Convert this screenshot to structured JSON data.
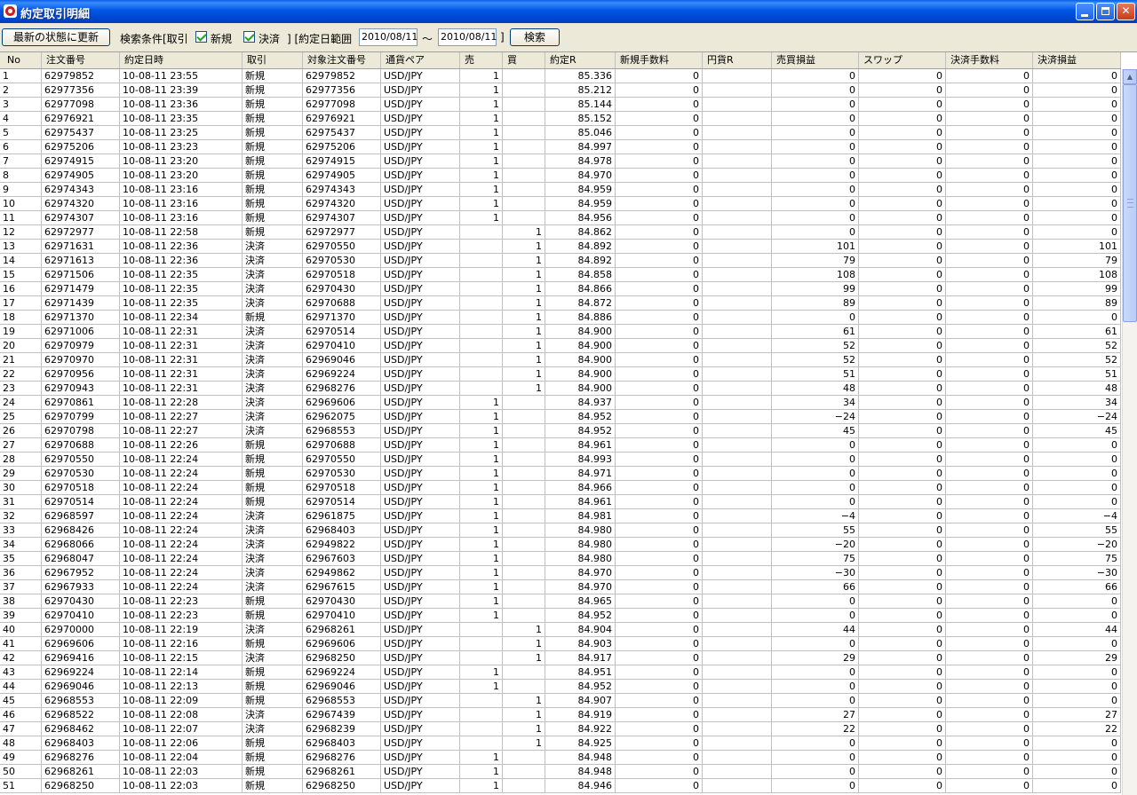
{
  "window": {
    "title": "約定取引明細"
  },
  "toolbar": {
    "refresh_label": "最新の状態に更新",
    "filter_label": "検索条件[取引",
    "check_new_label": "新規",
    "check_close_label": "決済",
    "range_label": "]  [約定日範囲",
    "date_from": "2010/08/11",
    "tilde": "～",
    "date_to": "2010/08/11",
    "range_close": "]",
    "search_label": "検索"
  },
  "table": {
    "columns": [
      "No",
      "注文番号",
      "約定日時",
      "取引",
      "対象注文番号",
      "通貨ペア",
      "売",
      "買",
      "約定R",
      "新規手数料",
      "円貨R",
      "売買損益",
      "スワップ",
      "決済手数料",
      "決済損益"
    ],
    "rows": [
      [
        "1",
        "62979852",
        "10-08-11 23:55",
        "新規",
        "62979852",
        "USD/JPY",
        "1",
        "",
        "85.336",
        "0",
        "",
        "0",
        "0",
        "0",
        "0"
      ],
      [
        "2",
        "62977356",
        "10-08-11 23:39",
        "新規",
        "62977356",
        "USD/JPY",
        "1",
        "",
        "85.212",
        "0",
        "",
        "0",
        "0",
        "0",
        "0"
      ],
      [
        "3",
        "62977098",
        "10-08-11 23:36",
        "新規",
        "62977098",
        "USD/JPY",
        "1",
        "",
        "85.144",
        "0",
        "",
        "0",
        "0",
        "0",
        "0"
      ],
      [
        "4",
        "62976921",
        "10-08-11 23:35",
        "新規",
        "62976921",
        "USD/JPY",
        "1",
        "",
        "85.152",
        "0",
        "",
        "0",
        "0",
        "0",
        "0"
      ],
      [
        "5",
        "62975437",
        "10-08-11 23:25",
        "新規",
        "62975437",
        "USD/JPY",
        "1",
        "",
        "85.046",
        "0",
        "",
        "0",
        "0",
        "0",
        "0"
      ],
      [
        "6",
        "62975206",
        "10-08-11 23:23",
        "新規",
        "62975206",
        "USD/JPY",
        "1",
        "",
        "84.997",
        "0",
        "",
        "0",
        "0",
        "0",
        "0"
      ],
      [
        "7",
        "62974915",
        "10-08-11 23:20",
        "新規",
        "62974915",
        "USD/JPY",
        "1",
        "",
        "84.978",
        "0",
        "",
        "0",
        "0",
        "0",
        "0"
      ],
      [
        "8",
        "62974905",
        "10-08-11 23:20",
        "新規",
        "62974905",
        "USD/JPY",
        "1",
        "",
        "84.970",
        "0",
        "",
        "0",
        "0",
        "0",
        "0"
      ],
      [
        "9",
        "62974343",
        "10-08-11 23:16",
        "新規",
        "62974343",
        "USD/JPY",
        "1",
        "",
        "84.959",
        "0",
        "",
        "0",
        "0",
        "0",
        "0"
      ],
      [
        "10",
        "62974320",
        "10-08-11 23:16",
        "新規",
        "62974320",
        "USD/JPY",
        "1",
        "",
        "84.959",
        "0",
        "",
        "0",
        "0",
        "0",
        "0"
      ],
      [
        "11",
        "62974307",
        "10-08-11 23:16",
        "新規",
        "62974307",
        "USD/JPY",
        "1",
        "",
        "84.956",
        "0",
        "",
        "0",
        "0",
        "0",
        "0"
      ],
      [
        "12",
        "62972977",
        "10-08-11 22:58",
        "新規",
        "62972977",
        "USD/JPY",
        "",
        "1",
        "84.862",
        "0",
        "",
        "0",
        "0",
        "0",
        "0"
      ],
      [
        "13",
        "62971631",
        "10-08-11 22:36",
        "決済",
        "62970550",
        "USD/JPY",
        "",
        "1",
        "84.892",
        "0",
        "",
        "101",
        "0",
        "0",
        "101"
      ],
      [
        "14",
        "62971613",
        "10-08-11 22:36",
        "決済",
        "62970530",
        "USD/JPY",
        "",
        "1",
        "84.892",
        "0",
        "",
        "79",
        "0",
        "0",
        "79"
      ],
      [
        "15",
        "62971506",
        "10-08-11 22:35",
        "決済",
        "62970518",
        "USD/JPY",
        "",
        "1",
        "84.858",
        "0",
        "",
        "108",
        "0",
        "0",
        "108"
      ],
      [
        "16",
        "62971479",
        "10-08-11 22:35",
        "決済",
        "62970430",
        "USD/JPY",
        "",
        "1",
        "84.866",
        "0",
        "",
        "99",
        "0",
        "0",
        "99"
      ],
      [
        "17",
        "62971439",
        "10-08-11 22:35",
        "決済",
        "62970688",
        "USD/JPY",
        "",
        "1",
        "84.872",
        "0",
        "",
        "89",
        "0",
        "0",
        "89"
      ],
      [
        "18",
        "62971370",
        "10-08-11 22:34",
        "新規",
        "62971370",
        "USD/JPY",
        "",
        "1",
        "84.886",
        "0",
        "",
        "0",
        "0",
        "0",
        "0"
      ],
      [
        "19",
        "62971006",
        "10-08-11 22:31",
        "決済",
        "62970514",
        "USD/JPY",
        "",
        "1",
        "84.900",
        "0",
        "",
        "61",
        "0",
        "0",
        "61"
      ],
      [
        "20",
        "62970979",
        "10-08-11 22:31",
        "決済",
        "62970410",
        "USD/JPY",
        "",
        "1",
        "84.900",
        "0",
        "",
        "52",
        "0",
        "0",
        "52"
      ],
      [
        "21",
        "62970970",
        "10-08-11 22:31",
        "決済",
        "62969046",
        "USD/JPY",
        "",
        "1",
        "84.900",
        "0",
        "",
        "52",
        "0",
        "0",
        "52"
      ],
      [
        "22",
        "62970956",
        "10-08-11 22:31",
        "決済",
        "62969224",
        "USD/JPY",
        "",
        "1",
        "84.900",
        "0",
        "",
        "51",
        "0",
        "0",
        "51"
      ],
      [
        "23",
        "62970943",
        "10-08-11 22:31",
        "決済",
        "62968276",
        "USD/JPY",
        "",
        "1",
        "84.900",
        "0",
        "",
        "48",
        "0",
        "0",
        "48"
      ],
      [
        "24",
        "62970861",
        "10-08-11 22:28",
        "決済",
        "62969606",
        "USD/JPY",
        "1",
        "",
        "84.937",
        "0",
        "",
        "34",
        "0",
        "0",
        "34"
      ],
      [
        "25",
        "62970799",
        "10-08-11 22:27",
        "決済",
        "62962075",
        "USD/JPY",
        "1",
        "",
        "84.952",
        "0",
        "",
        "−24",
        "0",
        "0",
        "−24"
      ],
      [
        "26",
        "62970798",
        "10-08-11 22:27",
        "決済",
        "62968553",
        "USD/JPY",
        "1",
        "",
        "84.952",
        "0",
        "",
        "45",
        "0",
        "0",
        "45"
      ],
      [
        "27",
        "62970688",
        "10-08-11 22:26",
        "新規",
        "62970688",
        "USD/JPY",
        "1",
        "",
        "84.961",
        "0",
        "",
        "0",
        "0",
        "0",
        "0"
      ],
      [
        "28",
        "62970550",
        "10-08-11 22:24",
        "新規",
        "62970550",
        "USD/JPY",
        "1",
        "",
        "84.993",
        "0",
        "",
        "0",
        "0",
        "0",
        "0"
      ],
      [
        "29",
        "62970530",
        "10-08-11 22:24",
        "新規",
        "62970530",
        "USD/JPY",
        "1",
        "",
        "84.971",
        "0",
        "",
        "0",
        "0",
        "0",
        "0"
      ],
      [
        "30",
        "62970518",
        "10-08-11 22:24",
        "新規",
        "62970518",
        "USD/JPY",
        "1",
        "",
        "84.966",
        "0",
        "",
        "0",
        "0",
        "0",
        "0"
      ],
      [
        "31",
        "62970514",
        "10-08-11 22:24",
        "新規",
        "62970514",
        "USD/JPY",
        "1",
        "",
        "84.961",
        "0",
        "",
        "0",
        "0",
        "0",
        "0"
      ],
      [
        "32",
        "62968597",
        "10-08-11 22:24",
        "決済",
        "62961875",
        "USD/JPY",
        "1",
        "",
        "84.981",
        "0",
        "",
        "−4",
        "0",
        "0",
        "−4"
      ],
      [
        "33",
        "62968426",
        "10-08-11 22:24",
        "決済",
        "62968403",
        "USD/JPY",
        "1",
        "",
        "84.980",
        "0",
        "",
        "55",
        "0",
        "0",
        "55"
      ],
      [
        "34",
        "62968066",
        "10-08-11 22:24",
        "決済",
        "62949822",
        "USD/JPY",
        "1",
        "",
        "84.980",
        "0",
        "",
        "−20",
        "0",
        "0",
        "−20"
      ],
      [
        "35",
        "62968047",
        "10-08-11 22:24",
        "決済",
        "62967603",
        "USD/JPY",
        "1",
        "",
        "84.980",
        "0",
        "",
        "75",
        "0",
        "0",
        "75"
      ],
      [
        "36",
        "62967952",
        "10-08-11 22:24",
        "決済",
        "62949862",
        "USD/JPY",
        "1",
        "",
        "84.970",
        "0",
        "",
        "−30",
        "0",
        "0",
        "−30"
      ],
      [
        "37",
        "62967933",
        "10-08-11 22:24",
        "決済",
        "62967615",
        "USD/JPY",
        "1",
        "",
        "84.970",
        "0",
        "",
        "66",
        "0",
        "0",
        "66"
      ],
      [
        "38",
        "62970430",
        "10-08-11 22:23",
        "新規",
        "62970430",
        "USD/JPY",
        "1",
        "",
        "84.965",
        "0",
        "",
        "0",
        "0",
        "0",
        "0"
      ],
      [
        "39",
        "62970410",
        "10-08-11 22:23",
        "新規",
        "62970410",
        "USD/JPY",
        "1",
        "",
        "84.952",
        "0",
        "",
        "0",
        "0",
        "0",
        "0"
      ],
      [
        "40",
        "62970000",
        "10-08-11 22:19",
        "決済",
        "62968261",
        "USD/JPY",
        "",
        "1",
        "84.904",
        "0",
        "",
        "44",
        "0",
        "0",
        "44"
      ],
      [
        "41",
        "62969606",
        "10-08-11 22:16",
        "新規",
        "62969606",
        "USD/JPY",
        "",
        "1",
        "84.903",
        "0",
        "",
        "0",
        "0",
        "0",
        "0"
      ],
      [
        "42",
        "62969416",
        "10-08-11 22:15",
        "決済",
        "62968250",
        "USD/JPY",
        "",
        "1",
        "84.917",
        "0",
        "",
        "29",
        "0",
        "0",
        "29"
      ],
      [
        "43",
        "62969224",
        "10-08-11 22:14",
        "新規",
        "62969224",
        "USD/JPY",
        "1",
        "",
        "84.951",
        "0",
        "",
        "0",
        "0",
        "0",
        "0"
      ],
      [
        "44",
        "62969046",
        "10-08-11 22:13",
        "新規",
        "62969046",
        "USD/JPY",
        "1",
        "",
        "84.952",
        "0",
        "",
        "0",
        "0",
        "0",
        "0"
      ],
      [
        "45",
        "62968553",
        "10-08-11 22:09",
        "新規",
        "62968553",
        "USD/JPY",
        "",
        "1",
        "84.907",
        "0",
        "",
        "0",
        "0",
        "0",
        "0"
      ],
      [
        "46",
        "62968522",
        "10-08-11 22:08",
        "決済",
        "62967439",
        "USD/JPY",
        "",
        "1",
        "84.919",
        "0",
        "",
        "27",
        "0",
        "0",
        "27"
      ],
      [
        "47",
        "62968462",
        "10-08-11 22:07",
        "決済",
        "62968239",
        "USD/JPY",
        "",
        "1",
        "84.922",
        "0",
        "",
        "22",
        "0",
        "0",
        "22"
      ],
      [
        "48",
        "62968403",
        "10-08-11 22:06",
        "新規",
        "62968403",
        "USD/JPY",
        "",
        "1",
        "84.925",
        "0",
        "",
        "0",
        "0",
        "0",
        "0"
      ],
      [
        "49",
        "62968276",
        "10-08-11 22:04",
        "新規",
        "62968276",
        "USD/JPY",
        "1",
        "",
        "84.948",
        "0",
        "",
        "0",
        "0",
        "0",
        "0"
      ],
      [
        "50",
        "62968261",
        "10-08-11 22:03",
        "新規",
        "62968261",
        "USD/JPY",
        "1",
        "",
        "84.948",
        "0",
        "",
        "0",
        "0",
        "0",
        "0"
      ],
      [
        "51",
        "62968250",
        "10-08-11 22:03",
        "新規",
        "62968250",
        "USD/JPY",
        "1",
        "",
        "84.946",
        "0",
        "",
        "0",
        "0",
        "0",
        "0"
      ]
    ]
  }
}
